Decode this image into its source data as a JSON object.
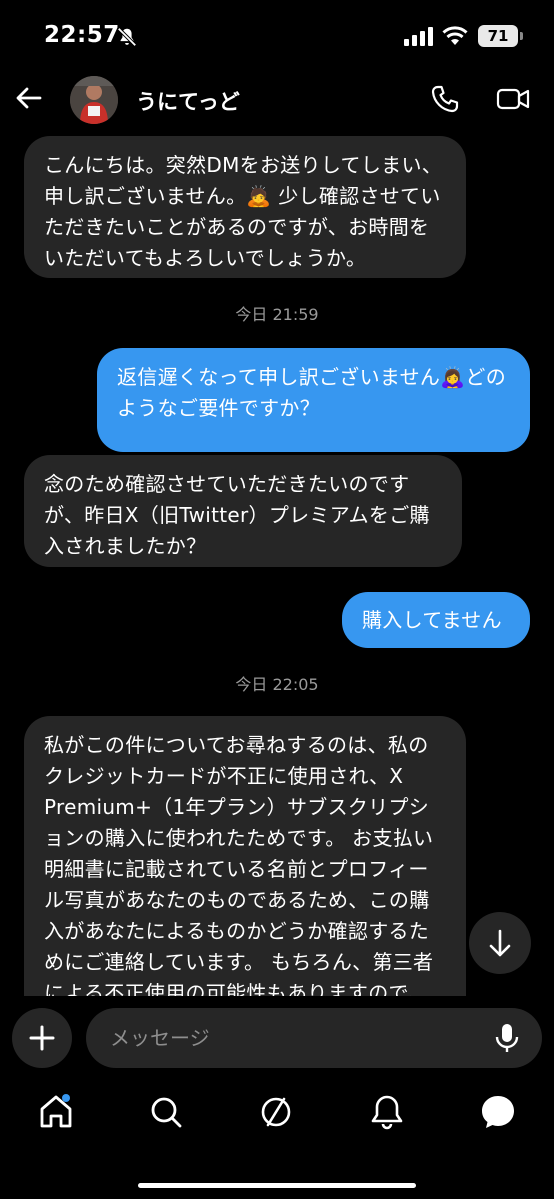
{
  "status_bar": {
    "time": "22:57",
    "battery": "71",
    "icons": [
      "bell-off-icon",
      "signal-icon",
      "wifi-icon",
      "battery-icon"
    ]
  },
  "header": {
    "contact_name": "うにてっど",
    "icons": [
      "back-arrow-icon",
      "phone-icon",
      "video-camera-icon"
    ]
  },
  "messages": [
    {
      "direction": "received",
      "text": "こんにちは。突然DMをお送りしてしまい、申し訳ございません。🙇 少し確認させていただきたいことがあるのですが、お時間をいただいてもよろしいでしょうか。"
    },
    {
      "type": "timestamp",
      "text": "今日 21:59"
    },
    {
      "direction": "sent",
      "text": "返信遅くなって申し訳ございません🙇‍♀️どのようなご要件ですか？"
    },
    {
      "direction": "received",
      "text": "念のため確認させていただきたいのですが、昨日X（旧Twitter）プレミアムをご購入されましたか？"
    },
    {
      "direction": "sent",
      "text": "購入してません"
    },
    {
      "type": "timestamp",
      "text": "今日 22:05"
    },
    {
      "direction": "received",
      "text": "私がこの件についてお尋ねするのは、私のクレジットカードが不正に使用され、X Premium+（1年プラン）サブスクリプションの購入に使われたためです。 お支払い明細書に記載されている名前とプロフィール写真があなたのものであるため、この購入があなたによるものかどうか確認するためにご連絡しています。 もちろん、第三者による不正使用の可能性もありますので、この件に関して何か情報がございました"
    }
  ],
  "composer": {
    "placeholder": "メッセージ",
    "icons": [
      "plus-icon",
      "microphone-icon"
    ]
  },
  "bottom_nav": {
    "items": [
      "home-icon",
      "search-icon",
      "explore-icon",
      "notifications-icon",
      "messages-icon"
    ],
    "home_has_badge": true
  },
  "colors": {
    "background": "#000000",
    "received_bubble": "#262626",
    "sent_bubble": "#3797f0",
    "timestamp_text": "#9a9a9a"
  }
}
